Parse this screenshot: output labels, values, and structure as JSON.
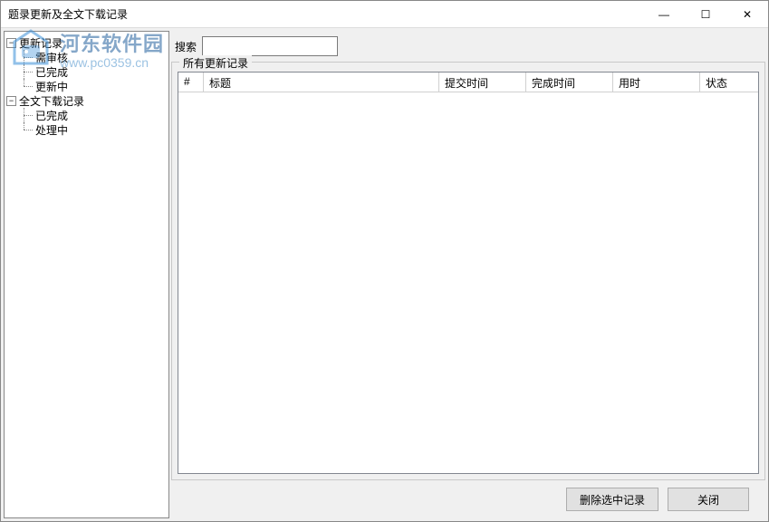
{
  "window": {
    "title": "题录更新及全文下载记录"
  },
  "titlebar_icons": {
    "min": "—",
    "max": "☐",
    "close": "✕"
  },
  "tree": {
    "root1": {
      "label": "更新记录",
      "toggle": "−"
    },
    "root1_children": [
      {
        "label": "需审核"
      },
      {
        "label": "已完成"
      },
      {
        "label": "更新中"
      }
    ],
    "root2": {
      "label": "全文下载记录",
      "toggle": "−"
    },
    "root2_children": [
      {
        "label": "已完成"
      },
      {
        "label": "处理中"
      }
    ]
  },
  "search": {
    "label": "搜索",
    "value": ""
  },
  "group": {
    "title": "所有更新记录"
  },
  "columns": {
    "c0": "#",
    "c1": "标题",
    "c2": "提交时间",
    "c3": "完成时间",
    "c4": "用时",
    "c5": "状态"
  },
  "footer": {
    "delete": "删除选中记录",
    "close": "关闭"
  },
  "watermark": {
    "line1": "河东软件园",
    "line2": "www.pc0359.cn"
  }
}
